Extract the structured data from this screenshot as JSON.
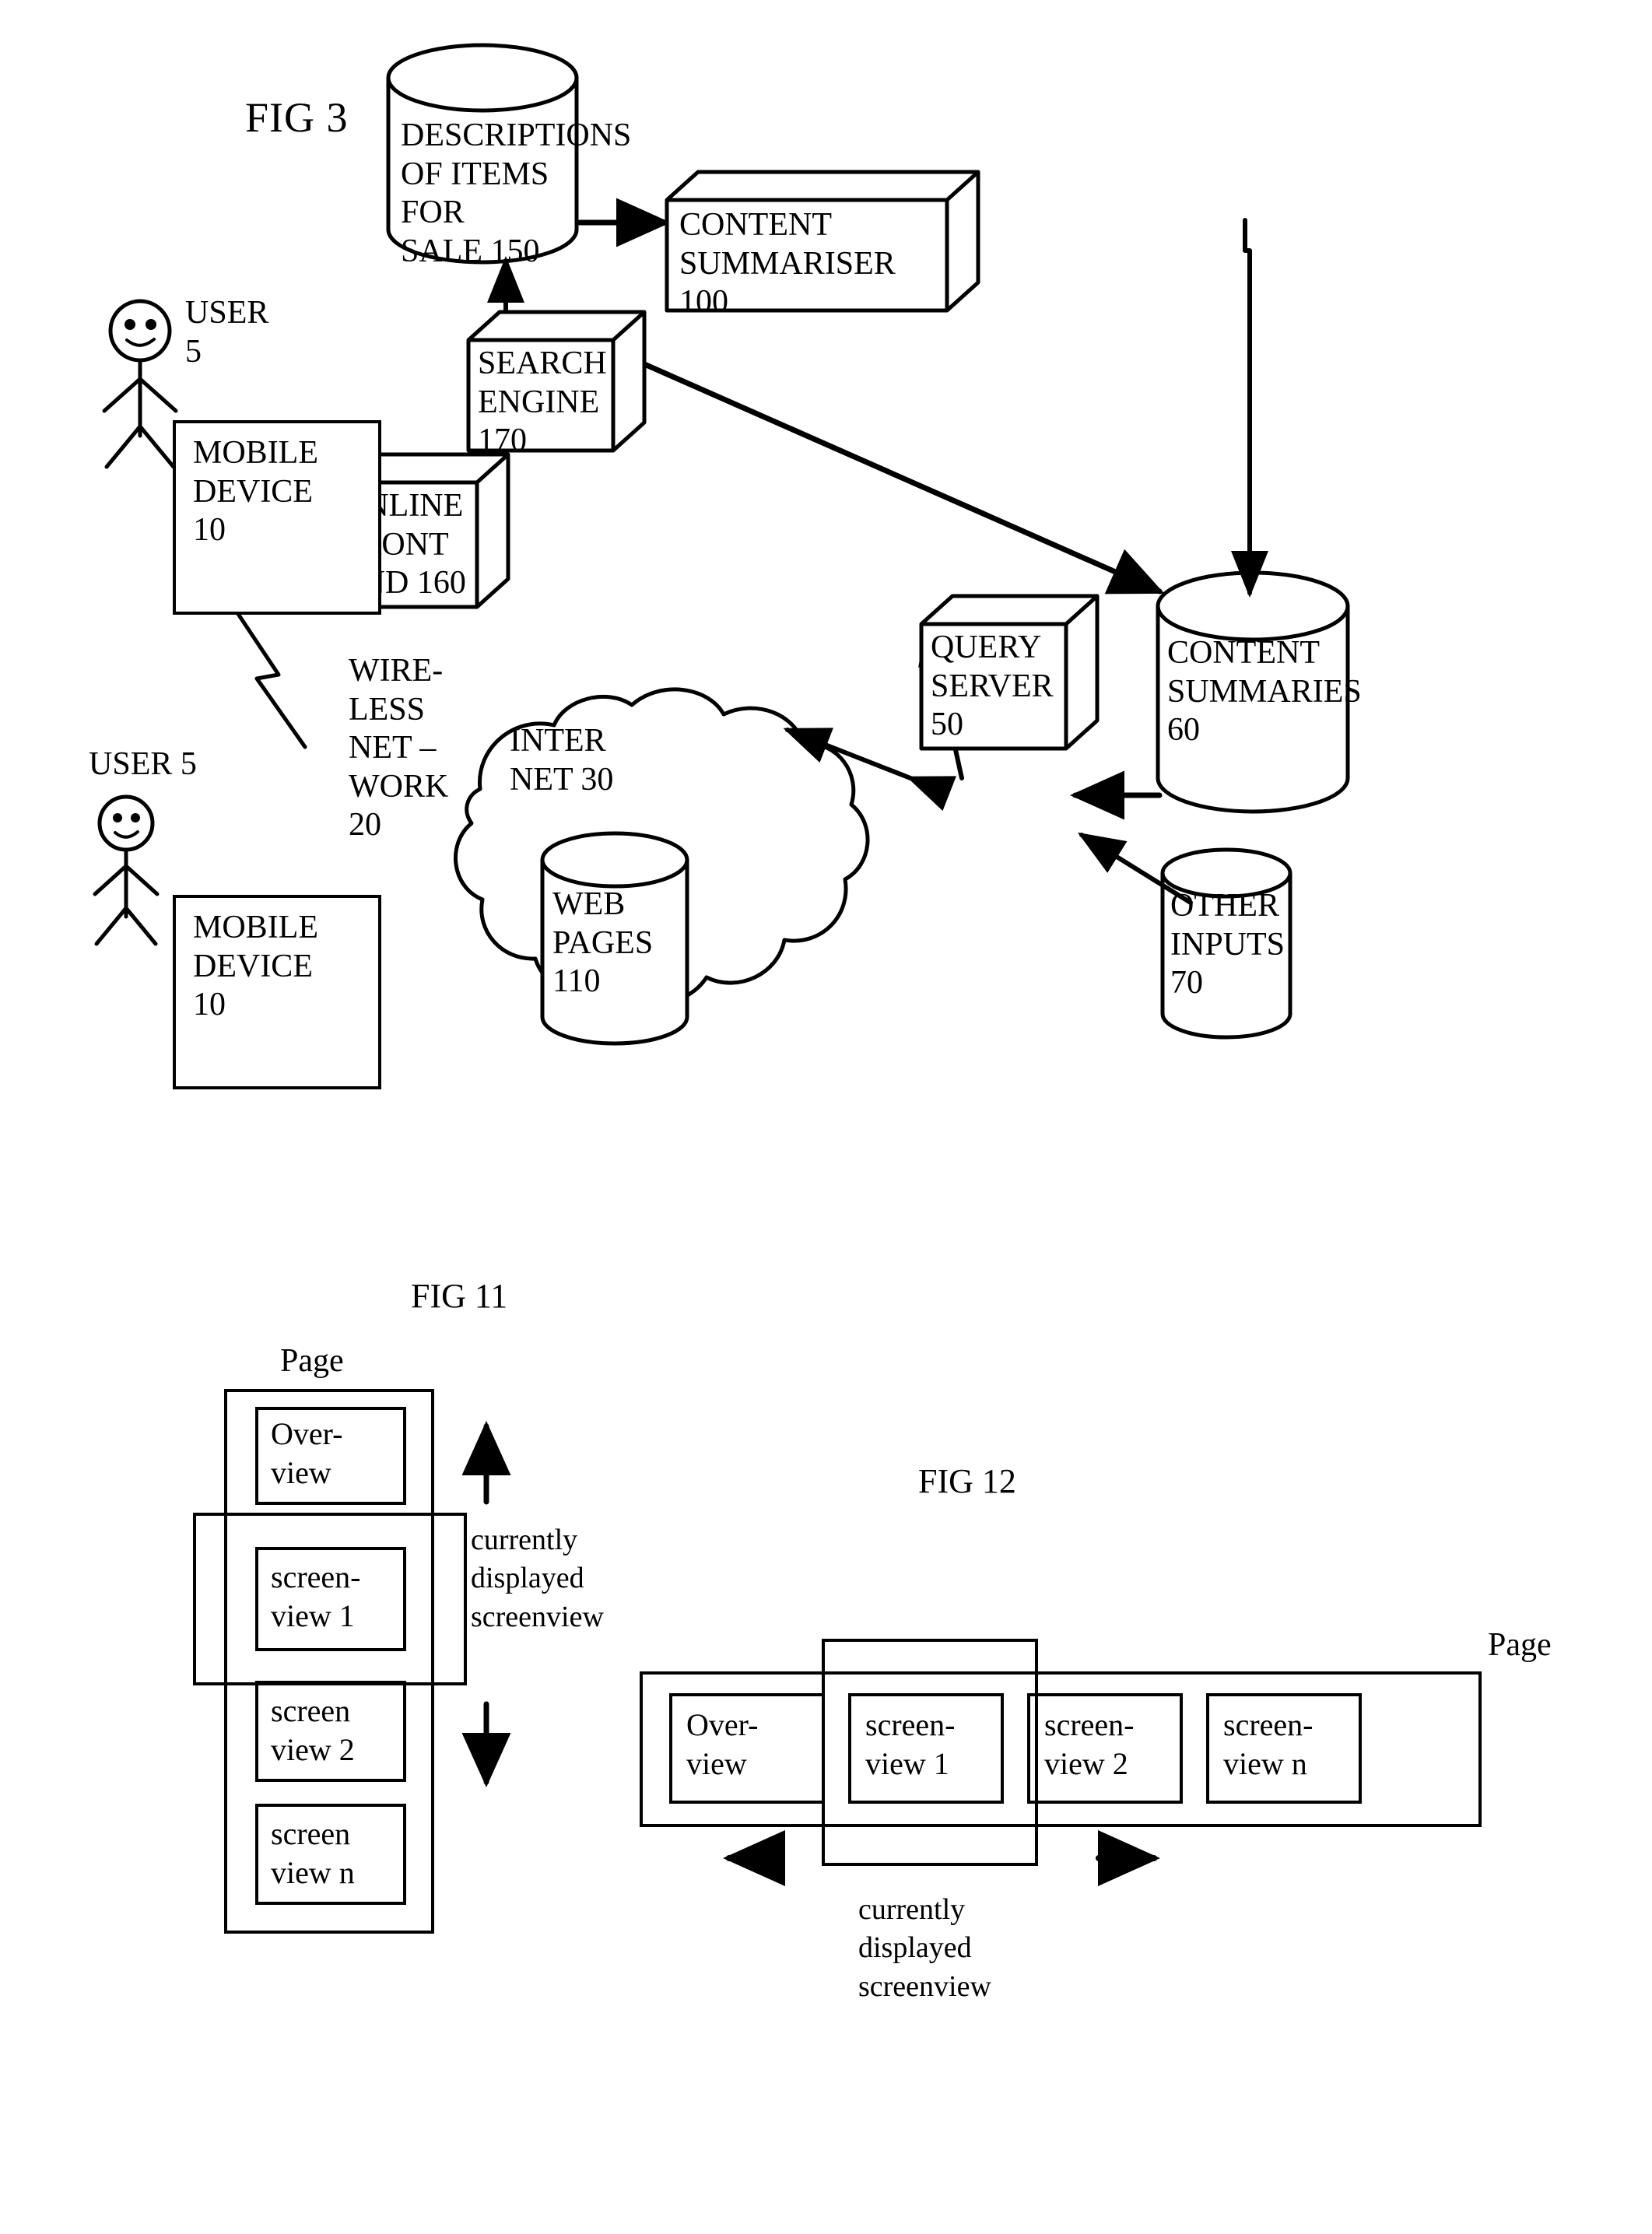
{
  "document": {
    "kind": "patent-drawing-sheet",
    "figures": [
      "FIG 3",
      "FIG 11",
      "FIG 12"
    ]
  },
  "fig3": {
    "title": "FIG 3",
    "nodes": {
      "user_top": "USER\n5",
      "mobile_device_top": "MOBILE\nDEVICE\n10",
      "user_bottom": "USER 5",
      "mobile_device_bottom": "MOBILE\nDEVICE\n10",
      "wireless_network": "WIRE-\nLESS\nNET –\nWORK\n20",
      "internet": "INTER\nNET 30",
      "web_pages": "WEB\nPAGES\n110",
      "online_front_end": "ONLINE\nFRONT\nEND 160",
      "search_engine": "SEARCH\nENGINE\n170",
      "descriptions_of_items": "DESCRIPTIONS\nOF ITEMS FOR\nSALE 150",
      "content_summariser": "CONTENT\nSUMMARISER\n100",
      "content_summaries": "CONTENT\nSUMMARIES\n60",
      "query_server": "QUERY\nSERVER\n50",
      "other_inputs": "OTHER\nINPUTS\n70"
    },
    "reference_numerals": {
      "user": "5",
      "mobile_device": "10",
      "wireless_network": "20",
      "internet": "30",
      "query_server": "50",
      "content_summaries": "60",
      "other_inputs": "70",
      "content_summariser": "100",
      "web_pages": "110",
      "descriptions_of_items_for_sale": "150",
      "online_front_end": "160",
      "search_engine": "170"
    }
  },
  "fig11": {
    "title": "FIG 11",
    "page_label": "Page",
    "boxes": [
      "Over-\nview",
      "screen-\nview 1",
      "screen\nview 2",
      "screen\nview n"
    ],
    "caption": "currently\ndisplayed\nscreenview",
    "arrows": [
      "up-arrow",
      "down-arrow"
    ]
  },
  "fig12": {
    "title": "FIG 12",
    "page_label": "Page",
    "boxes": [
      "Over-\nview",
      "screen-\nview 1",
      "screen-\nview 2",
      "screen-\nview n"
    ],
    "caption": "currently\ndisplayed\nscreenview",
    "arrows": [
      "left-arrow",
      "right-arrow"
    ]
  },
  "colors": {
    "ink": "#000000",
    "paper": "#ffffff"
  }
}
